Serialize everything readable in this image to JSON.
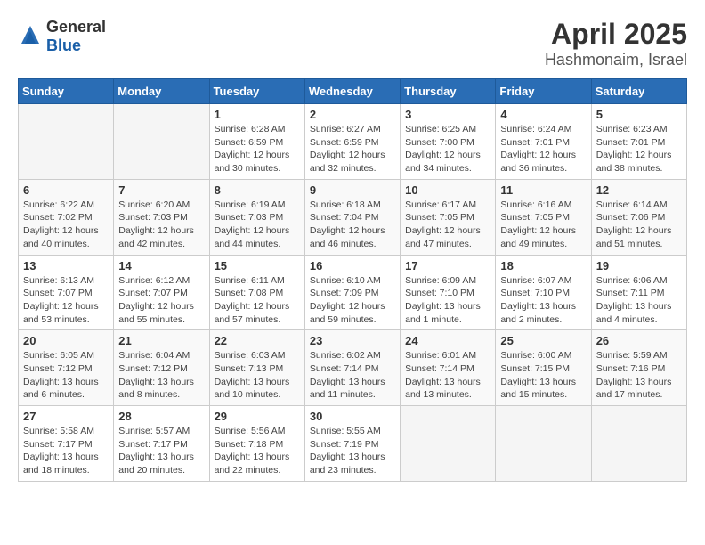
{
  "header": {
    "logo": {
      "general": "General",
      "blue": "Blue"
    },
    "title": "April 2025",
    "location": "Hashmonaim, Israel"
  },
  "calendar": {
    "weekdays": [
      "Sunday",
      "Monday",
      "Tuesday",
      "Wednesday",
      "Thursday",
      "Friday",
      "Saturday"
    ],
    "weeks": [
      [
        {
          "day": null
        },
        {
          "day": null
        },
        {
          "day": "1",
          "sunrise": "Sunrise: 6:28 AM",
          "sunset": "Sunset: 6:59 PM",
          "daylight": "Daylight: 12 hours and 30 minutes."
        },
        {
          "day": "2",
          "sunrise": "Sunrise: 6:27 AM",
          "sunset": "Sunset: 6:59 PM",
          "daylight": "Daylight: 12 hours and 32 minutes."
        },
        {
          "day": "3",
          "sunrise": "Sunrise: 6:25 AM",
          "sunset": "Sunset: 7:00 PM",
          "daylight": "Daylight: 12 hours and 34 minutes."
        },
        {
          "day": "4",
          "sunrise": "Sunrise: 6:24 AM",
          "sunset": "Sunset: 7:01 PM",
          "daylight": "Daylight: 12 hours and 36 minutes."
        },
        {
          "day": "5",
          "sunrise": "Sunrise: 6:23 AM",
          "sunset": "Sunset: 7:01 PM",
          "daylight": "Daylight: 12 hours and 38 minutes."
        }
      ],
      [
        {
          "day": "6",
          "sunrise": "Sunrise: 6:22 AM",
          "sunset": "Sunset: 7:02 PM",
          "daylight": "Daylight: 12 hours and 40 minutes."
        },
        {
          "day": "7",
          "sunrise": "Sunrise: 6:20 AM",
          "sunset": "Sunset: 7:03 PM",
          "daylight": "Daylight: 12 hours and 42 minutes."
        },
        {
          "day": "8",
          "sunrise": "Sunrise: 6:19 AM",
          "sunset": "Sunset: 7:03 PM",
          "daylight": "Daylight: 12 hours and 44 minutes."
        },
        {
          "day": "9",
          "sunrise": "Sunrise: 6:18 AM",
          "sunset": "Sunset: 7:04 PM",
          "daylight": "Daylight: 12 hours and 46 minutes."
        },
        {
          "day": "10",
          "sunrise": "Sunrise: 6:17 AM",
          "sunset": "Sunset: 7:05 PM",
          "daylight": "Daylight: 12 hours and 47 minutes."
        },
        {
          "day": "11",
          "sunrise": "Sunrise: 6:16 AM",
          "sunset": "Sunset: 7:05 PM",
          "daylight": "Daylight: 12 hours and 49 minutes."
        },
        {
          "day": "12",
          "sunrise": "Sunrise: 6:14 AM",
          "sunset": "Sunset: 7:06 PM",
          "daylight": "Daylight: 12 hours and 51 minutes."
        }
      ],
      [
        {
          "day": "13",
          "sunrise": "Sunrise: 6:13 AM",
          "sunset": "Sunset: 7:07 PM",
          "daylight": "Daylight: 12 hours and 53 minutes."
        },
        {
          "day": "14",
          "sunrise": "Sunrise: 6:12 AM",
          "sunset": "Sunset: 7:07 PM",
          "daylight": "Daylight: 12 hours and 55 minutes."
        },
        {
          "day": "15",
          "sunrise": "Sunrise: 6:11 AM",
          "sunset": "Sunset: 7:08 PM",
          "daylight": "Daylight: 12 hours and 57 minutes."
        },
        {
          "day": "16",
          "sunrise": "Sunrise: 6:10 AM",
          "sunset": "Sunset: 7:09 PM",
          "daylight": "Daylight: 12 hours and 59 minutes."
        },
        {
          "day": "17",
          "sunrise": "Sunrise: 6:09 AM",
          "sunset": "Sunset: 7:10 PM",
          "daylight": "Daylight: 13 hours and 1 minute."
        },
        {
          "day": "18",
          "sunrise": "Sunrise: 6:07 AM",
          "sunset": "Sunset: 7:10 PM",
          "daylight": "Daylight: 13 hours and 2 minutes."
        },
        {
          "day": "19",
          "sunrise": "Sunrise: 6:06 AM",
          "sunset": "Sunset: 7:11 PM",
          "daylight": "Daylight: 13 hours and 4 minutes."
        }
      ],
      [
        {
          "day": "20",
          "sunrise": "Sunrise: 6:05 AM",
          "sunset": "Sunset: 7:12 PM",
          "daylight": "Daylight: 13 hours and 6 minutes."
        },
        {
          "day": "21",
          "sunrise": "Sunrise: 6:04 AM",
          "sunset": "Sunset: 7:12 PM",
          "daylight": "Daylight: 13 hours and 8 minutes."
        },
        {
          "day": "22",
          "sunrise": "Sunrise: 6:03 AM",
          "sunset": "Sunset: 7:13 PM",
          "daylight": "Daylight: 13 hours and 10 minutes."
        },
        {
          "day": "23",
          "sunrise": "Sunrise: 6:02 AM",
          "sunset": "Sunset: 7:14 PM",
          "daylight": "Daylight: 13 hours and 11 minutes."
        },
        {
          "day": "24",
          "sunrise": "Sunrise: 6:01 AM",
          "sunset": "Sunset: 7:14 PM",
          "daylight": "Daylight: 13 hours and 13 minutes."
        },
        {
          "day": "25",
          "sunrise": "Sunrise: 6:00 AM",
          "sunset": "Sunset: 7:15 PM",
          "daylight": "Daylight: 13 hours and 15 minutes."
        },
        {
          "day": "26",
          "sunrise": "Sunrise: 5:59 AM",
          "sunset": "Sunset: 7:16 PM",
          "daylight": "Daylight: 13 hours and 17 minutes."
        }
      ],
      [
        {
          "day": "27",
          "sunrise": "Sunrise: 5:58 AM",
          "sunset": "Sunset: 7:17 PM",
          "daylight": "Daylight: 13 hours and 18 minutes."
        },
        {
          "day": "28",
          "sunrise": "Sunrise: 5:57 AM",
          "sunset": "Sunset: 7:17 PM",
          "daylight": "Daylight: 13 hours and 20 minutes."
        },
        {
          "day": "29",
          "sunrise": "Sunrise: 5:56 AM",
          "sunset": "Sunset: 7:18 PM",
          "daylight": "Daylight: 13 hours and 22 minutes."
        },
        {
          "day": "30",
          "sunrise": "Sunrise: 5:55 AM",
          "sunset": "Sunset: 7:19 PM",
          "daylight": "Daylight: 13 hours and 23 minutes."
        },
        {
          "day": null
        },
        {
          "day": null
        },
        {
          "day": null
        }
      ]
    ]
  }
}
